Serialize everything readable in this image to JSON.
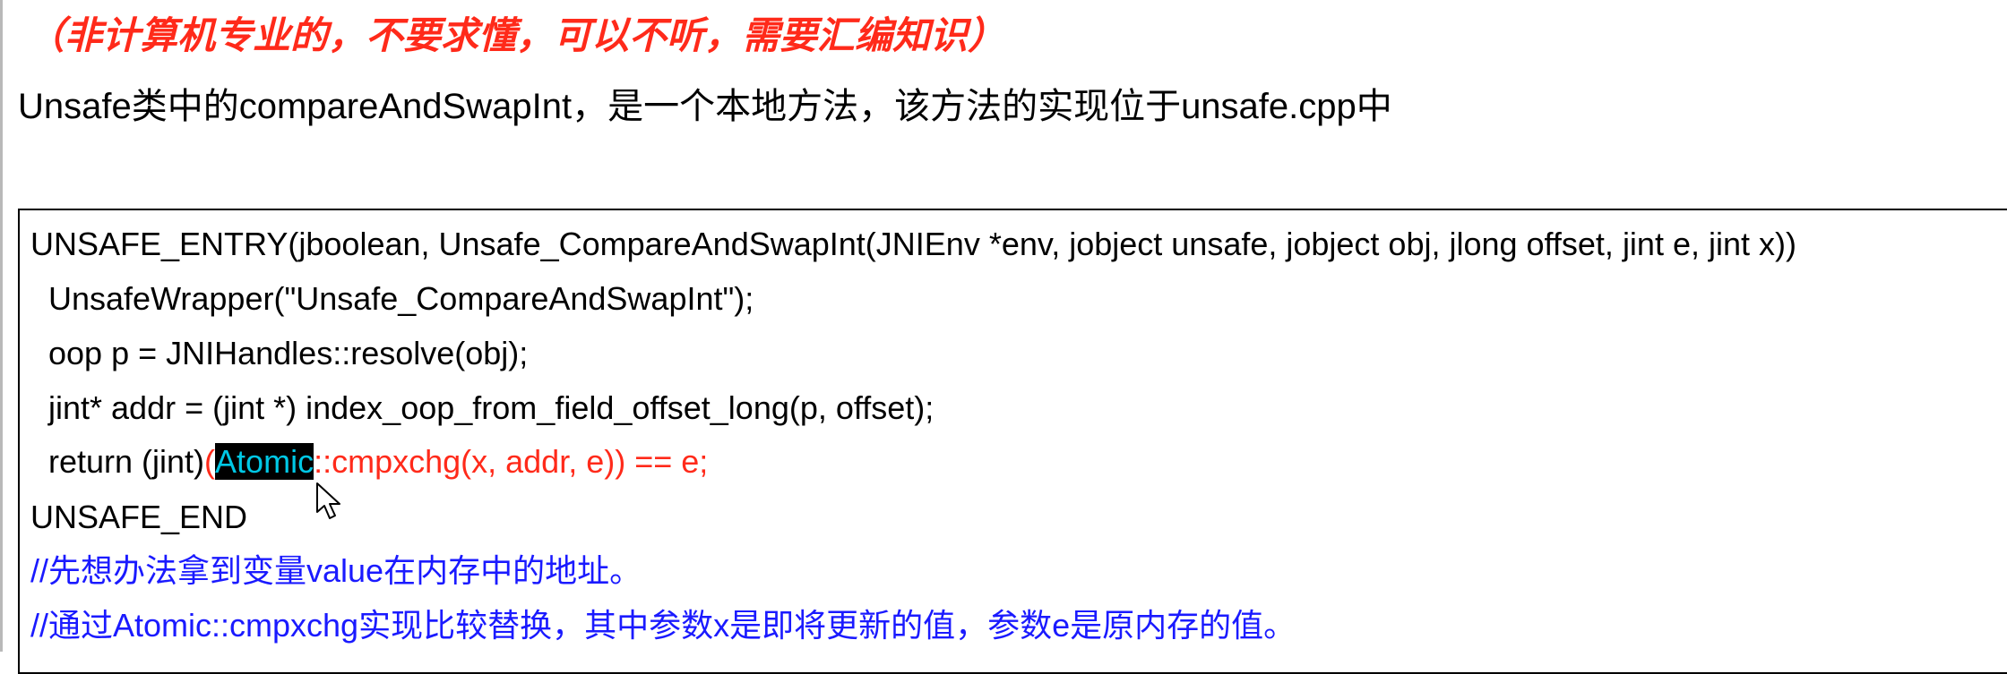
{
  "note": "（非计算机专业的，不要求懂，可以不听，需要汇编知识）",
  "intro": "Unsafe类中的compareAndSwapInt，是一个本地方法，该方法的实现位于unsafe.cpp中",
  "code": {
    "line1": "UNSAFE_ENTRY(jboolean, Unsafe_CompareAndSwapInt(JNIEnv *env, jobject unsafe, jobject obj, jlong offset, jint e, jint x))",
    "line2": "UnsafeWrapper(\"Unsafe_CompareAndSwapInt\");",
    "line3": "oop p = JNIHandles::resolve(obj);",
    "line4": "jint* addr = (jint *) index_oop_from_field_offset_long(p, offset);",
    "line5_prefix": "return (jint)",
    "line5_paren": "(",
    "line5_selected": "Atomic",
    "line5_suffix": "::cmpxchg(x, addr, e)) == e;",
    "line6": "UNSAFE_END",
    "comment1": "//先想办法拿到变量value在内存中的地址。",
    "comment2": "//通过Atomic::cmpxchg实现比较替换，其中参数x是即将更新的值，参数e是原内存的值。"
  },
  "colors": {
    "note": "#ff2a1a",
    "highlight_code": "#ff2a1a",
    "selection_bg": "#000000",
    "selection_text": "#00c8e6",
    "comment": "#1a1aff"
  },
  "icons": {
    "cursor": "mouse-pointer-icon"
  }
}
